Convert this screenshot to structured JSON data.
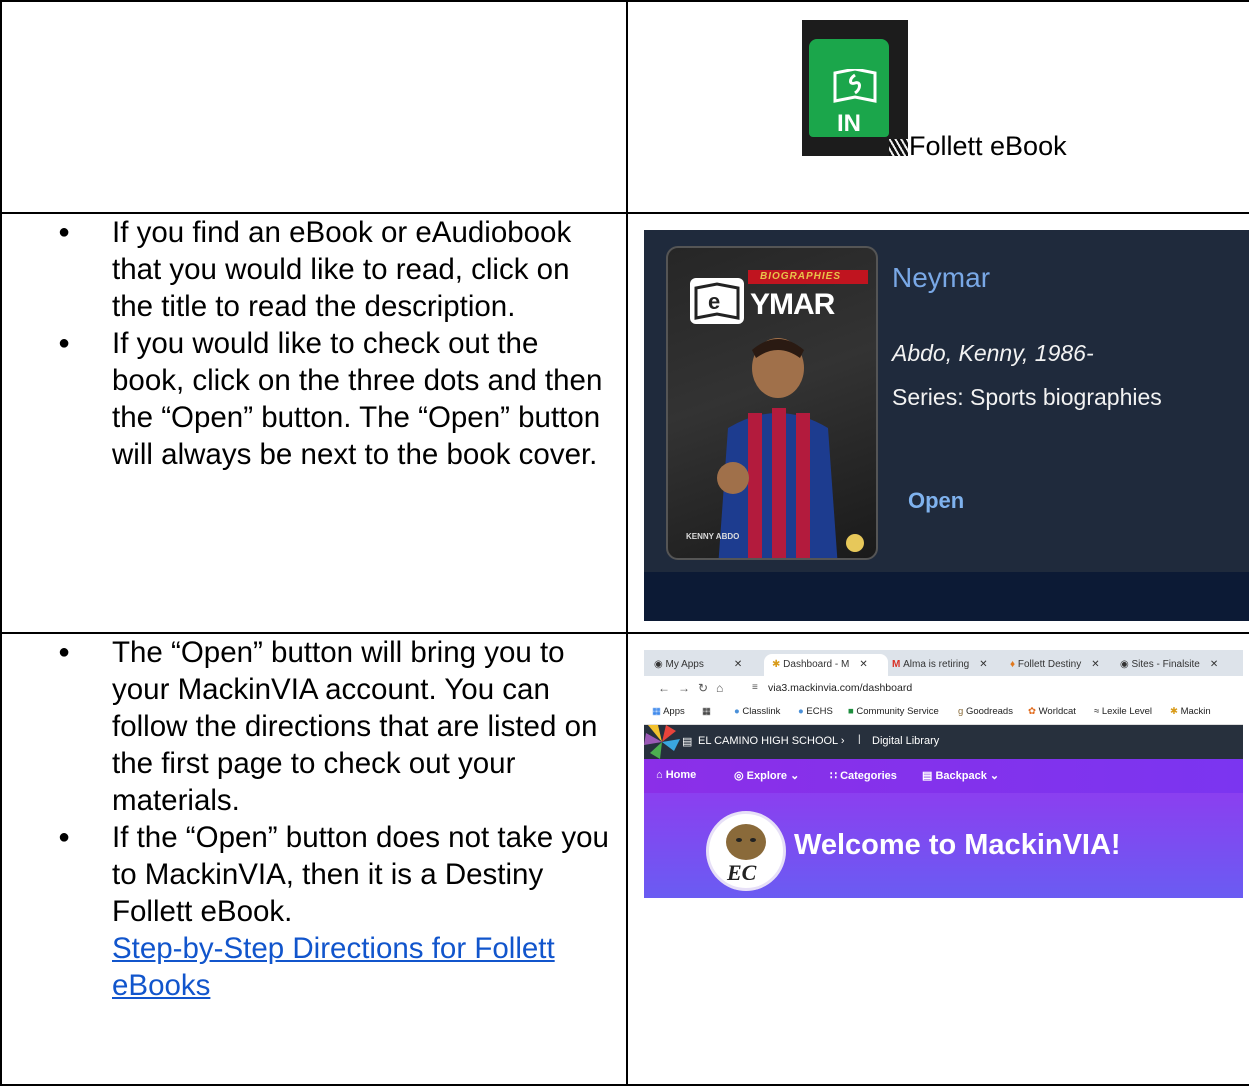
{
  "row1": {
    "logo_text": "IN",
    "caption": "Follett eBook"
  },
  "row2": {
    "bullets": [
      "If you find an eBook or eAudiobook that you would like to read, click on the title to read the description.",
      "If you would like to check out the book, click on the three dots and then the “Open” button. The “Open” button will always be next to the book cover."
    ],
    "card": {
      "cover_series_label": "BIOGRAPHIES",
      "cover_title_partial": "YMAR",
      "cover_author": "KENNY ABDO",
      "title": "Neymar",
      "author": "Abdo, Kenny, 1986-",
      "series": "Series: Sports biographies",
      "open_label": "Open"
    }
  },
  "row3": {
    "bullet1": "The “Open” button will bring you to your MackinVIA account.  You can follow the directions that are listed on the first page to check out your materials.",
    "bullet2_text": "If the “Open” button does not take you to MackinVIA, then it is a Destiny Follett eBook.",
    "link_text": "Step-by-Step Directions for Follett eBooks",
    "browser": {
      "tabs": [
        {
          "label": "My Apps"
        },
        {
          "label": "Dashboard - M"
        },
        {
          "label": "Alma is retiring"
        },
        {
          "label": "Follett Destiny"
        },
        {
          "label": "Sites - Finalsite"
        }
      ],
      "url": "via3.mackinvia.com/dashboard",
      "bookmarks": [
        "Apps",
        "Classlink",
        "ECHS",
        "Community Service",
        "Goodreads",
        "Worldcat",
        "Lexile Level",
        "Mackin"
      ],
      "school": "EL CAMINO HIGH SCHOOL",
      "section": "Digital Library",
      "nav": [
        "Home",
        "Explore",
        "Categories",
        "Backpack"
      ],
      "mascot_text": "EC",
      "welcome": "Welcome to MackinVIA!"
    }
  }
}
